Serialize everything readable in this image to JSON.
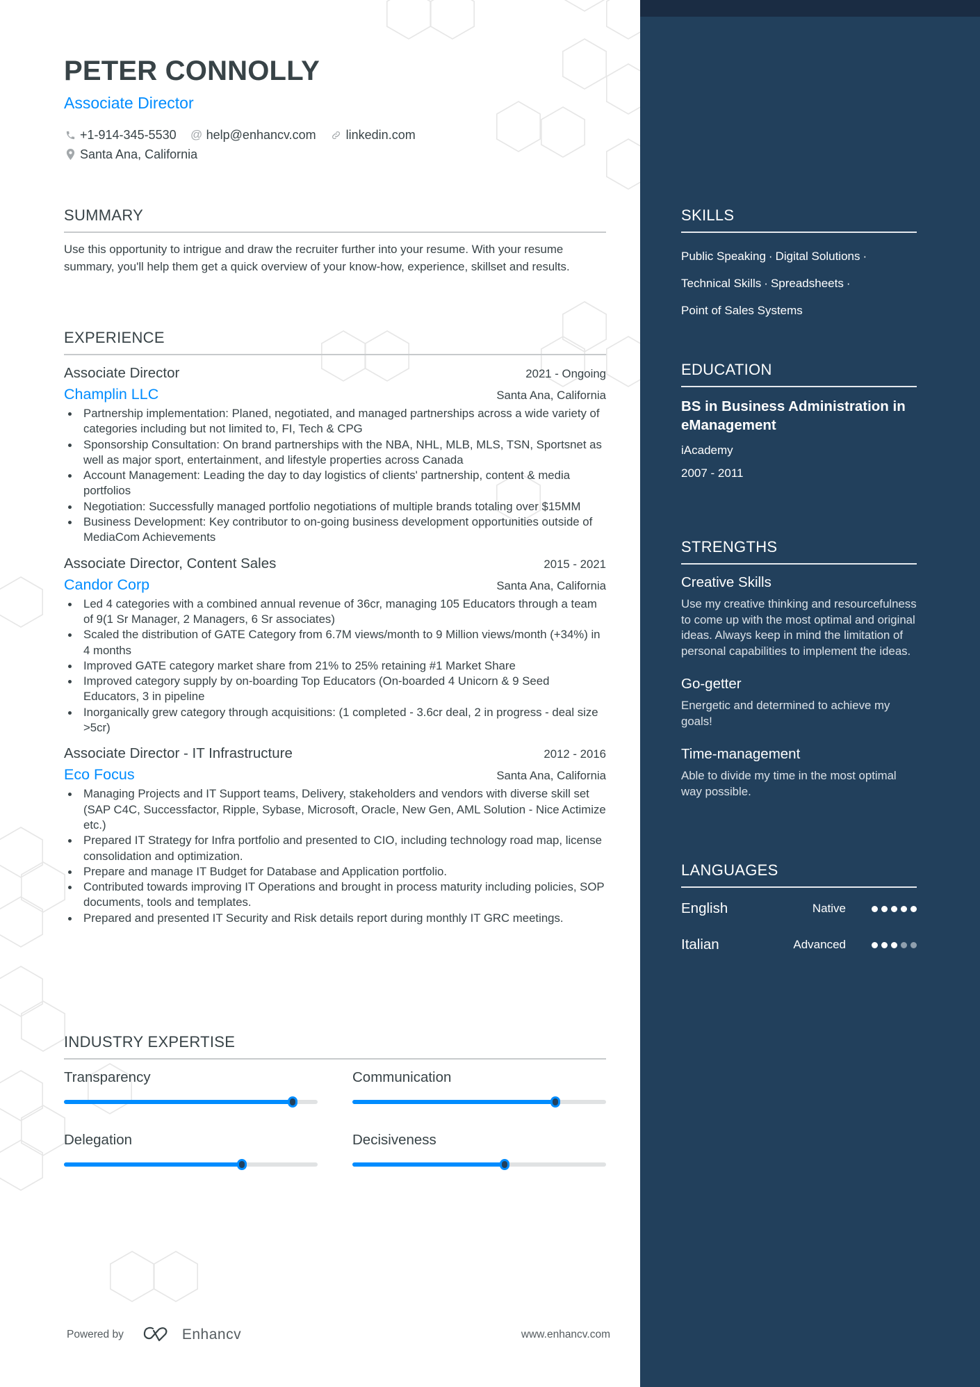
{
  "header": {
    "name": "PETER CONNOLLY",
    "title": "Associate Director",
    "contacts": [
      {
        "icon": "phone-icon",
        "text": "+1-914-345-5530"
      },
      {
        "icon": "at-icon",
        "text": "help@enhancv.com"
      },
      {
        "icon": "link-icon",
        "text": "linkedin.com"
      },
      {
        "icon": "location-pin-icon",
        "text": "Santa Ana, California"
      }
    ]
  },
  "summary": {
    "title": "SUMMARY",
    "text": "Use this opportunity to intrigue and draw the recruiter further into your resume. With your resume summary, you'll help them get a quick overview of your know-how, experience, skillset and results."
  },
  "experience": {
    "title": "EXPERIENCE",
    "jobs": [
      {
        "role": "Associate Director",
        "dates": "2021 - Ongoing",
        "company": "Champlin LLC",
        "location": "Santa Ana, California",
        "bullets": [
          "Partnership implementation: Planed, negotiated, and managed partnerships across a wide variety of categories including but not limited to, FI, Tech & CPG",
          "Sponsorship Consultation: On brand partnerships with the NBA, NHL, MLB, MLS, TSN, Sportsnet as well as major sport, entertainment, and lifestyle properties across Canada",
          "Account Management: Leading the day to day logistics of clients' partnership, content & media portfolios",
          "Negotiation: Successfully managed portfolio negotiations of multiple brands totaling over $15MM",
          "Business Development: Key contributor to on-going business development opportunities outside of MediaCom Achievements"
        ]
      },
      {
        "role": "Associate Director, Content Sales",
        "dates": "2015 - 2021",
        "company": "Candor Corp",
        "location": "Santa Ana, California",
        "bullets": [
          "Led 4 categories with a combined annual revenue of 36cr, managing 105 Educators through a team of 9(1 Sr Manager, 2 Managers, 6 Sr associates)",
          "Scaled the distribution of GATE Category from 6.7M views/month to 9 Million views/month (+34%) in 4 months",
          "Improved GATE category market share from 21% to 25% retaining #1 Market Share",
          "Improved category supply by on-boarding Top Educators (On-boarded 4 Unicorn & 9 Seed Educators, 3 in pipeline",
          "Inorganically grew category through acquisitions: (1  completed - 3.6cr deal, 2 in progress - deal size >5cr)"
        ]
      },
      {
        "role": "Associate Director - IT Infrastructure",
        "dates": "2012 - 2016",
        "company": "Eco Focus",
        "location": "Santa Ana, California",
        "bullets": [
          "Managing Projects and IT Support teams, Delivery, stakeholders and vendors with diverse skill set (SAP C4C, Successfactor, Ripple, Sybase, Microsoft, Oracle, New Gen, AML Solution - Nice Actimize etc.)",
          "Prepared IT Strategy for Infra portfolio and presented to CIO, including technology road map, license consolidation and optimization.",
          "Prepare and manage IT Budget for Database and Application portfolio.",
          "Contributed towards improving IT Operations and brought in process maturity including policies, SOP documents, tools and templates.",
          "Prepared and presented IT Security and Risk details report during monthly IT GRC meetings."
        ]
      }
    ]
  },
  "industry_expertise": {
    "title": "INDUSTRY EXPERTISE",
    "items": [
      {
        "label": "Transparency",
        "level": 0.9
      },
      {
        "label": "Communication",
        "level": 0.8
      },
      {
        "label": "Delegation",
        "level": 0.7
      },
      {
        "label": "Decisiveness",
        "level": 0.6
      }
    ]
  },
  "footer": {
    "powered_by": "Powered by",
    "brand": "Enhancv",
    "url": "www.enhancv.com"
  },
  "sidebar": {
    "skills": {
      "title": "SKILLS",
      "lines": [
        [
          "Public Speaking",
          "Digital Solutions"
        ],
        [
          "Technical Skills",
          "Spreadsheets"
        ],
        [
          "Point of Sales Systems"
        ]
      ],
      "separator": "·"
    },
    "education": {
      "title": "EDUCATION",
      "degree": "BS in Business Administration in eManagement",
      "school": "iAcademy",
      "dates": "2007 - 2011"
    },
    "strengths": {
      "title": "STRENGTHS",
      "items": [
        {
          "title": "Creative Skills",
          "description": "Use my creative thinking and resourcefulness to come up with the most optimal and original ideas. Always keep in mind the limitation of personal capabilities to implement the ideas."
        },
        {
          "title": "Go-getter",
          "description": "Energetic and determined to achieve my goals!"
        },
        {
          "title": "Time-management",
          "description": "Able to divide my time in the most optimal way possible."
        }
      ]
    },
    "languages": {
      "title": "LANGUAGES",
      "items": [
        {
          "name": "English",
          "level": "Native",
          "dots_filled": 5,
          "dots_total": 5
        },
        {
          "name": "Italian",
          "level": "Advanced",
          "dots_filled": 3,
          "dots_total": 5
        }
      ]
    }
  },
  "colors": {
    "accent": "#008cff",
    "sidebar": "#22405c",
    "sidebar_topbar": "#1a2c43",
    "text": "#384347"
  }
}
